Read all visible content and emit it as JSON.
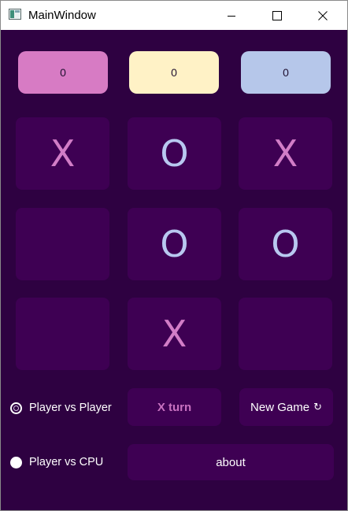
{
  "window": {
    "title": "MainWindow",
    "icon": "app-window-icon",
    "controls": [
      "minimize-icon",
      "maximize-icon",
      "close-icon"
    ]
  },
  "scores": {
    "x": "0",
    "draw": "0",
    "o": "0"
  },
  "board": {
    "cells": [
      "X",
      "O",
      "X",
      "",
      "O",
      "O",
      "",
      "X",
      ""
    ]
  },
  "modes": {
    "pvp_label": "Player vs Player",
    "pvp_selected": true,
    "cpu_label": "Player vs CPU",
    "cpu_selected": false
  },
  "controls": {
    "turn_label": "X turn",
    "new_game_label": "New Game",
    "new_game_icon": "↻",
    "about_label": "about"
  },
  "colors": {
    "background": "#2e0141",
    "cell": "#3e0053",
    "x_mark": "#d27dc7",
    "o_mark": "#b8c8f0",
    "score_x": "#d77bc4",
    "score_draw": "#fff2c6",
    "score_o": "#b6c7ea"
  }
}
